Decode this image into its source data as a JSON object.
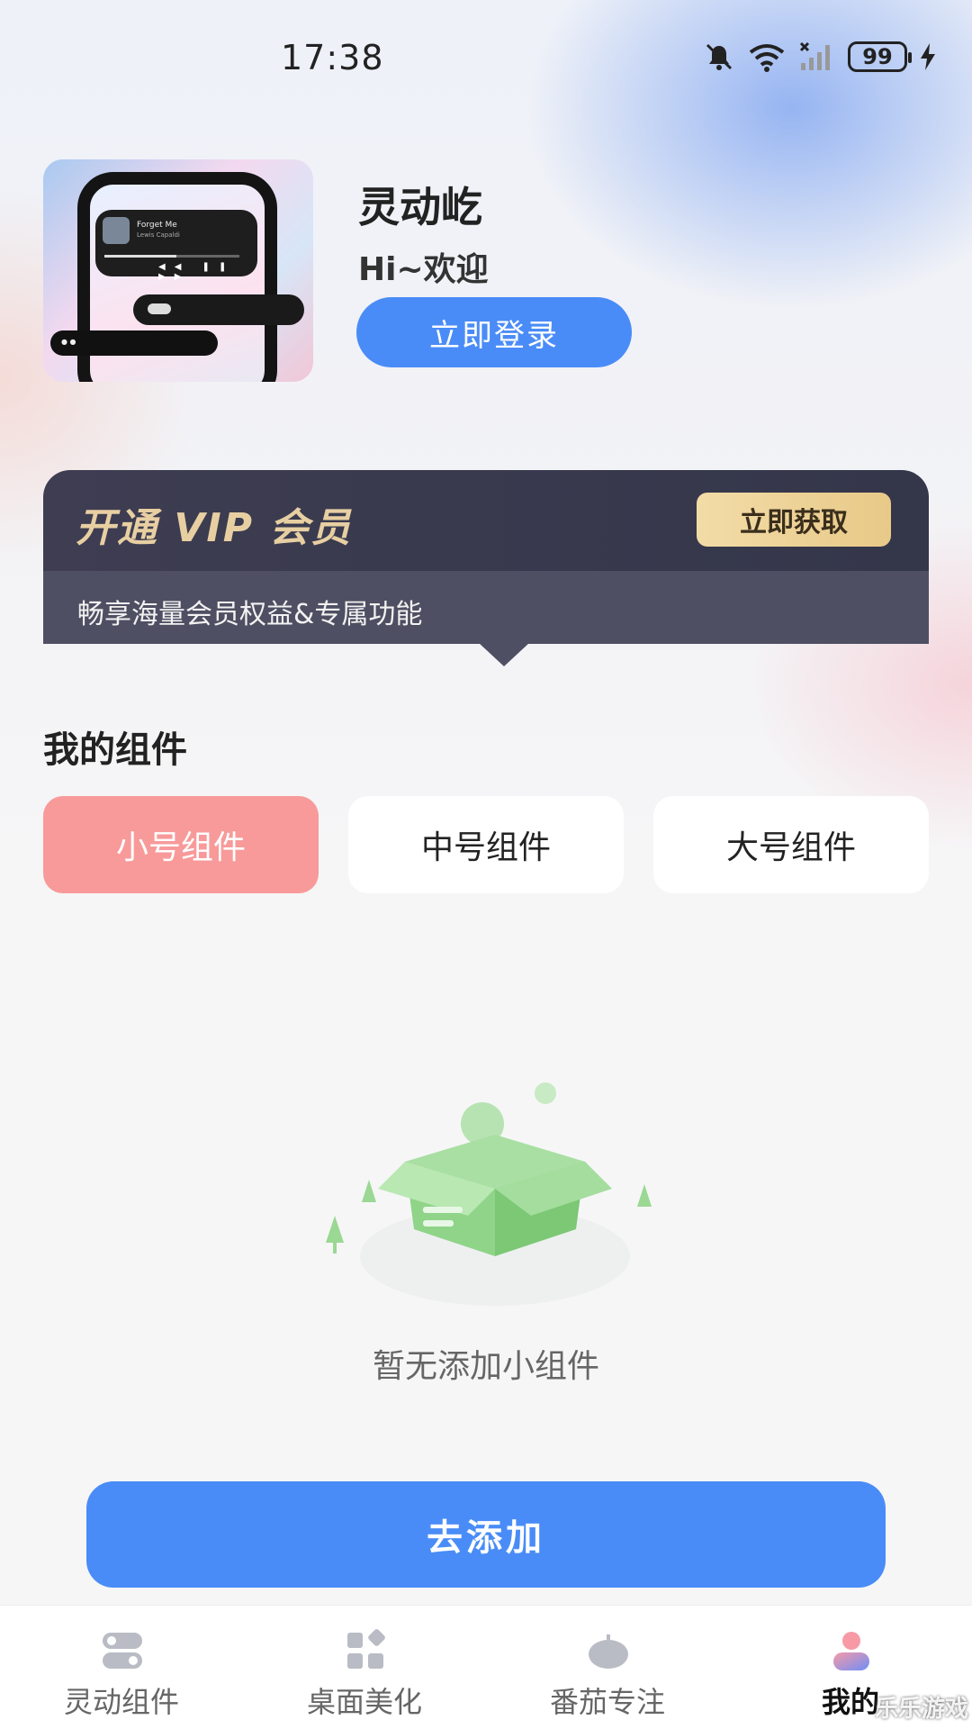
{
  "status_bar": {
    "time": "17:38",
    "battery": "99"
  },
  "profile": {
    "app_name": "灵动屹",
    "greeting": "Hi~欢迎",
    "login_label": "立即登录",
    "preview_music_title": "Forget Me",
    "preview_music_artist": "Lewis Capaldi"
  },
  "vip": {
    "title": "开通 VIP 会员",
    "description": "畅享海量会员权益&专属功能",
    "button_label": "立即获取"
  },
  "widgets": {
    "section_title": "我的组件",
    "tabs": [
      {
        "label": "小号组件",
        "active": true
      },
      {
        "label": "中号组件",
        "active": false
      },
      {
        "label": "大号组件",
        "active": false
      }
    ],
    "empty_text": "暂无添加小组件",
    "add_label": "去添加"
  },
  "bottom_nav": [
    {
      "label": "灵动组件",
      "icon": "toggle-icon"
    },
    {
      "label": "桌面美化",
      "icon": "grid-icon"
    },
    {
      "label": "番茄专注",
      "icon": "tomato-icon"
    },
    {
      "label": "我的",
      "icon": "user-icon",
      "active": true
    }
  ],
  "watermark": "乐乐游戏",
  "colors": {
    "primary_blue": "#4a8cf7",
    "active_tab": "#f89a9a",
    "vip_gold": "#e8cfa2",
    "vip_dark": "#3e3d52"
  }
}
